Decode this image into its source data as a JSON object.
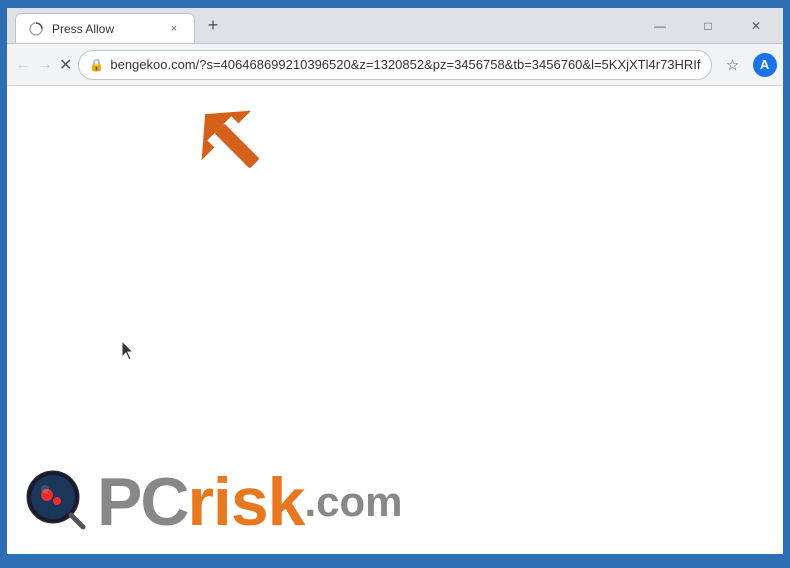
{
  "browser": {
    "title": "Press Allow",
    "url": "bengekoo.com/?s=406468699210396520&z=1320852&pz=3456758&tb=3456760&l=5KXjXTl4r73HRIf",
    "new_tab_label": "+",
    "tab_close_label": "×"
  },
  "window_controls": {
    "minimize_label": "—",
    "maximize_label": "□",
    "close_label": "✕"
  },
  "nav": {
    "back_label": "←",
    "forward_label": "→",
    "reload_label": "✕"
  },
  "toolbar_icons": {
    "star_label": "☆",
    "profile_initial": "A",
    "menu_label": "⋮"
  },
  "watermark": {
    "pc_label": "PC",
    "risk_label": "risk",
    "dotcom_label": ".com"
  },
  "colors": {
    "accent_blue": "#2d6eb5",
    "arrow_orange": "#e06010",
    "logo_gray": "#888888",
    "logo_orange": "#e87820"
  }
}
